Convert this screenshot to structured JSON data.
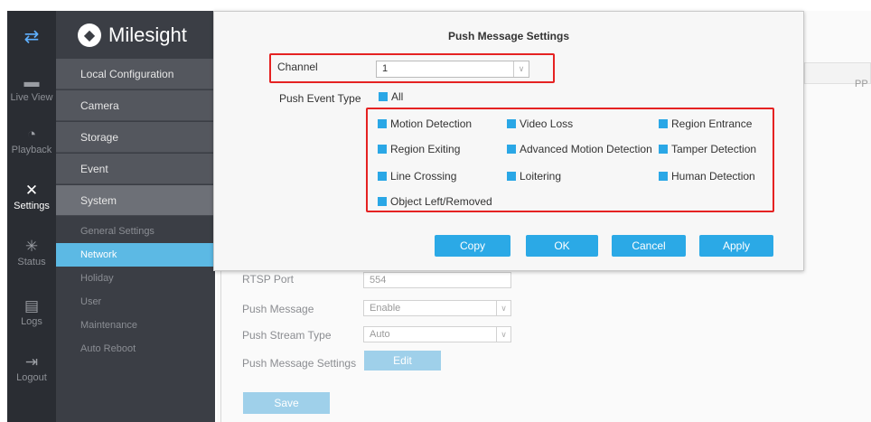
{
  "rail": {
    "items": [
      {
        "label": "Live View",
        "icon": "live-view-icon",
        "glyph": "▬"
      },
      {
        "label": "Playback",
        "icon": "playback-icon",
        "glyph": "◔"
      },
      {
        "label": "Settings",
        "icon": "settings-tools-icon",
        "glyph": "✕"
      },
      {
        "label": "Status",
        "icon": "status-icon",
        "glyph": "✳"
      },
      {
        "label": "Logs",
        "icon": "logs-icon",
        "glyph": "▤"
      },
      {
        "label": "Logout",
        "icon": "logout-icon",
        "glyph": "⇥"
      }
    ],
    "top_icon": "swap-arrows-icon",
    "top_glyph": "⇄"
  },
  "menu": {
    "logo": "Milesight",
    "items": [
      "Local Configuration",
      "Camera",
      "Storage",
      "Event",
      "System"
    ],
    "sub_items": [
      "General Settings",
      "Network",
      "Holiday",
      "User",
      "Maintenance",
      "Auto Reboot"
    ]
  },
  "background": {
    "tab_label": "PP",
    "rtsp_port_label": "RTSP Port",
    "rtsp_port_value": "554",
    "push_message_label": "Push Message",
    "push_message_value": "Enable",
    "push_stream_type_label": "Push Stream Type",
    "push_stream_type_value": "Auto",
    "push_message_settings_label": "Push Message Settings",
    "edit_button": "Edit",
    "save_button": "Save"
  },
  "dialog": {
    "title": "Push Message Settings",
    "channel_label": "Channel",
    "channel_value": "1",
    "push_event_type_label": "Push Event Type",
    "all_label": "All",
    "events": [
      "Motion Detection",
      "Video Loss",
      "Region Entrance",
      "Region Exiting",
      "Advanced Motion Detection",
      "Tamper Detection",
      "Line Crossing",
      "Loitering",
      "Human Detection",
      "Object Left/Removed"
    ],
    "buttons": {
      "copy": "Copy",
      "ok": "OK",
      "cancel": "Cancel",
      "apply": "Apply"
    }
  },
  "colors": {
    "accent": "#2ba9e6",
    "annotation": "#e52222",
    "sidebar": "#3b3e45",
    "rail": "#2a2d33"
  }
}
